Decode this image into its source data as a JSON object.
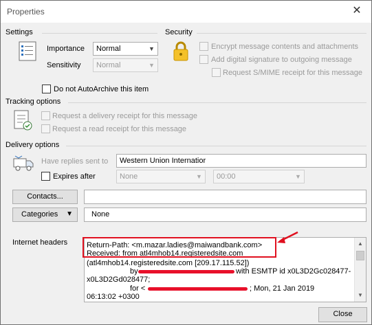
{
  "window": {
    "title": "Properties",
    "close_glyph": "✕"
  },
  "settings": {
    "title": "Settings",
    "importance_label": "Importance",
    "importance_value": "Normal",
    "sensitivity_label": "Sensitivity",
    "sensitivity_value": "Normal",
    "autoarchive_label": "Do not AutoArchive this item"
  },
  "security": {
    "title": "Security",
    "encrypt_label": "Encrypt message contents and attachments",
    "signature_label": "Add digital signature to outgoing message",
    "smime_label": "Request S/MIME receipt for this message"
  },
  "tracking": {
    "title": "Tracking options",
    "delivery_receipt_label": "Request a delivery receipt for this message",
    "read_receipt_label": "Request a read receipt for this message"
  },
  "delivery": {
    "title": "Delivery options",
    "replies_label": "Have replies sent to",
    "replies_value": "Western Union Internatior",
    "expires_label": "Expires after",
    "expires_date_value": "None",
    "expires_time_value": "00:00"
  },
  "contacts": {
    "button_label": "Contacts...",
    "value": ""
  },
  "categories": {
    "button_label": "Categories",
    "arrow": "▼",
    "value": "None"
  },
  "internet_headers": {
    "label": "Internet headers",
    "lines": [
      "Return-Path: <m.mazar.ladies@maiwandbank.com>",
      "Received: from atl4mhob14.registeredsite.com",
      "(atl4mhob14.registeredsite.com [209.17.115.52])",
      "by",
      "with ESMTP id x0L3D2Gc028477-",
      "x0L3D2Gd028477;",
      "for <",
      "; Mon, 21 Jan 2019",
      "06:13:02 +0300"
    ]
  },
  "footer": {
    "close_label": "Close"
  },
  "colors": {
    "annotation": "#e0101f",
    "window_bg": "#f0f0f0"
  }
}
